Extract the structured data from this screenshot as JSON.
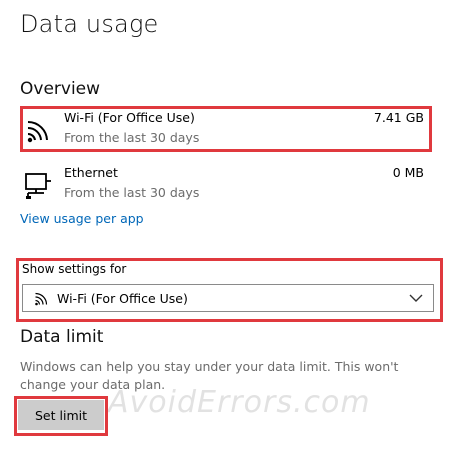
{
  "page": {
    "title": "Data usage"
  },
  "overview": {
    "heading": "Overview",
    "items": [
      {
        "icon": "wifi-icon",
        "name": "Wi-Fi (For Office Use)",
        "sub": "From the last 30 days",
        "amount": "7.41 GB"
      },
      {
        "icon": "ethernet-icon",
        "name": "Ethernet",
        "sub": "From the last 30 days",
        "amount": "0 MB"
      }
    ],
    "link_label": "View usage per app"
  },
  "settings": {
    "label": "Show settings for",
    "selected": "Wi-Fi (For Office Use)",
    "selected_icon": "wifi-icon"
  },
  "data_limit": {
    "heading": "Data limit",
    "description": "Windows can help you stay under your data limit. This won't change your data plan.",
    "button_label": "Set limit"
  },
  "watermark": "AvoidErrors.com",
  "colors": {
    "accent_link": "#0067b8",
    "highlight_box": "#e0393e",
    "button_bg": "#cccccc",
    "secondary_text": "#6b6b6b"
  }
}
